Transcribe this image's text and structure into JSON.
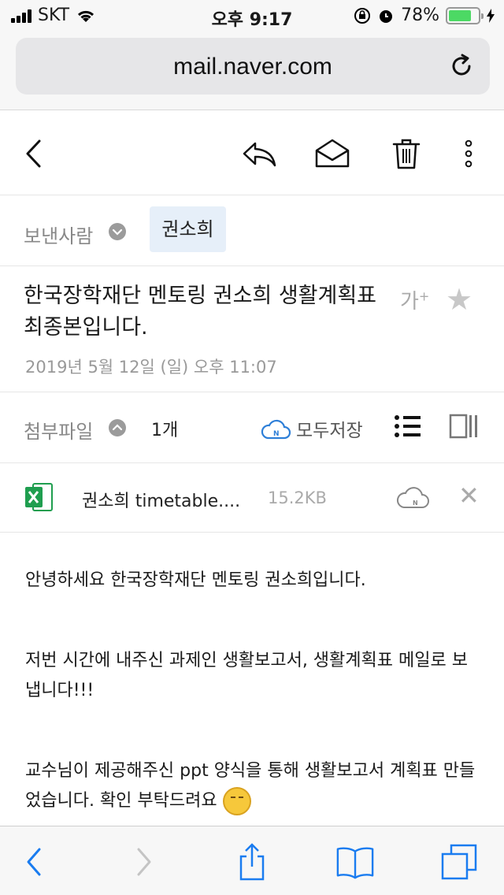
{
  "status_bar": {
    "carrier": "SKT",
    "time": "오후 9:17",
    "battery": "78%",
    "battery_level": 0.78
  },
  "browser": {
    "url": "mail.naver.com"
  },
  "toolbar": {
    "icons": [
      "back-icon",
      "reply-icon",
      "mark-read-icon",
      "trash-icon",
      "more-icon"
    ]
  },
  "mail": {
    "sender_label": "보낸사람",
    "sender_name": "권소희",
    "subject": "한국장학재단 멘토링 권소희 생활계획표 최종본입니다.",
    "date": "2019년 5월 12일 (일) 오후 11:07",
    "font_size_label": "가",
    "font_size_sup": "+"
  },
  "attachments": {
    "label": "첨부파일",
    "count": "1개",
    "save_all": "모두저장",
    "files": [
      {
        "name": "권소희 timetable....",
        "size": "15.2KB"
      }
    ]
  },
  "body": {
    "lines": [
      "안녕하세요 한국장학재단 멘토링 권소희입니다.",
      "저번 시간에 내주신 과제인 생활보고서, 생활계획표 메일로 보냅니다!!!",
      "교수님이 제공해주신 ppt 양식을 통해 생활보고서 계획표 만들었습니다. 확인 부탁드려요"
    ]
  },
  "colors": {
    "accent": "#1a7cf0",
    "excel_green": "#1f9e4f",
    "chip_bg": "#e6eff9"
  }
}
